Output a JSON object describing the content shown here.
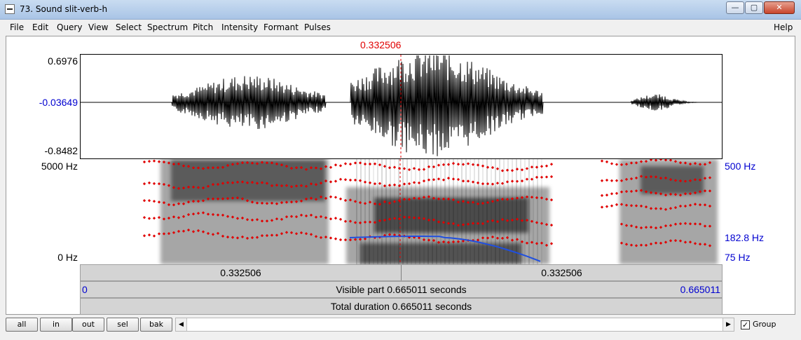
{
  "window": {
    "title": "73. Sound slit-verb-h",
    "buttons": {
      "minimize": "—",
      "maximize": "▢",
      "close": "✕"
    }
  },
  "menu": [
    "File",
    "Edit",
    "Query",
    "View",
    "Select",
    "Spectrum",
    "Pitch",
    "Intensity",
    "Formant",
    "Pulses"
  ],
  "help_label": "Help",
  "cursor_time": "0.332506",
  "waveform": {
    "y_max": "0.6976",
    "y_mid": "-0.03649",
    "y_min": "-0.8482"
  },
  "spectrogram": {
    "freq_top": "5000 Hz",
    "freq_bottom": "0 Hz",
    "pitch_top": "500 Hz",
    "pitch_value": "182.8 Hz",
    "pitch_bottom": "75 Hz"
  },
  "time_bars": {
    "left_segment": "0.332506",
    "right_segment": "0.332506",
    "visible_start": "0",
    "visible_text": "Visible part 0.665011 seconds",
    "visible_end": "0.665011",
    "total_text": "Total duration 0.665011 seconds"
  },
  "zoom_buttons": [
    "all",
    "in",
    "out",
    "sel",
    "bak"
  ],
  "group_label": "Group",
  "group_checked": "✓",
  "colors": {
    "cursor": "#e00000",
    "axis_blue": "#0000d0",
    "formant": "#e00000",
    "pitch": "#1f4fe0"
  }
}
